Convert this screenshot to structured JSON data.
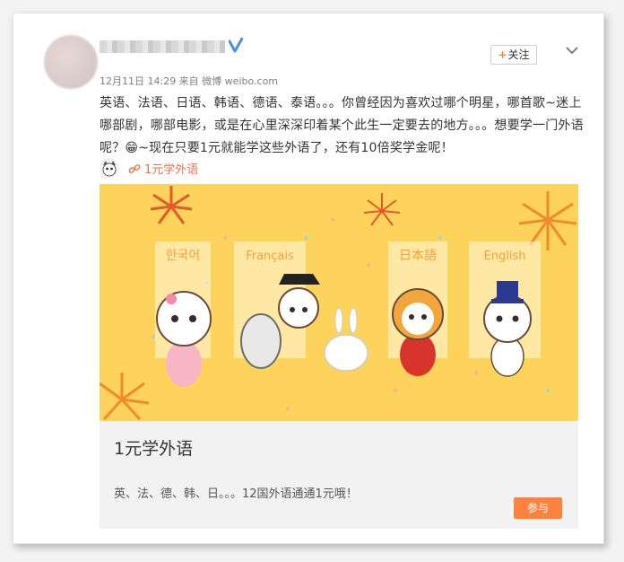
{
  "post": {
    "meta": "12月11日 14:29 来自 微博 weibo.com",
    "follow_label": "关注",
    "text": "英语、法语、日语、韩语、德语、泰语。。。你曾经因为喜欢过哪个明星，哪首歌~迷上哪部剧，哪部电影，或是在心里深深印着某个此生一定要去的地方。。。想要学一门外语呢？😁~现在只要1元就能学这些外语了，还有10倍奖学金呢！",
    "link_text": "1元学外语"
  },
  "media": {
    "languages": [
      "한국어",
      "Français",
      "日本語",
      "English"
    ],
    "title": "1元学外语",
    "description": "英、法、德、韩、日。。。12国外语通通1元哦！",
    "join_label": "参与"
  },
  "colors": {
    "accent": "#ff8140",
    "link": "#eb7350",
    "banner_bg": "#fdd35b",
    "verified": "#4a90e2"
  },
  "icons": {
    "verified": "verified-badge-icon",
    "chevron": "chevron-down-icon",
    "link": "link-icon"
  }
}
